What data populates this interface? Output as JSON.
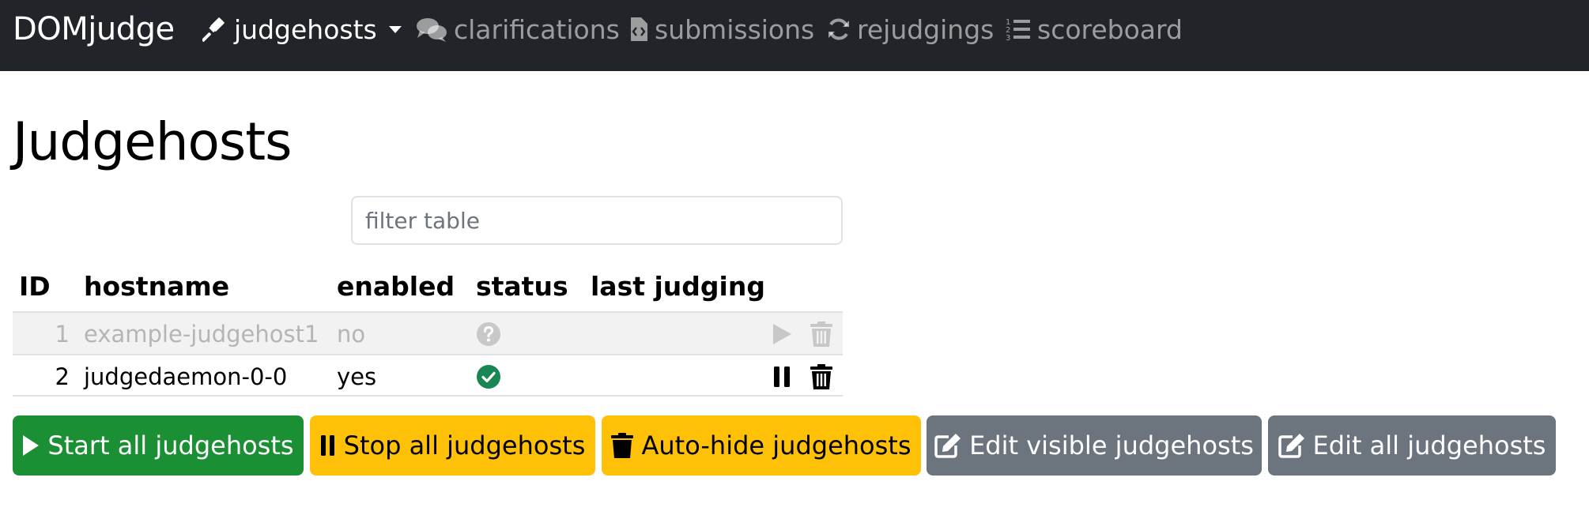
{
  "navbar": {
    "brand": "DOMjudge",
    "items": [
      {
        "label": "judgehosts",
        "icon": "gavel-icon"
      },
      {
        "label": "clarifications",
        "icon": "comments-icon"
      },
      {
        "label": "submissions",
        "icon": "file-code-icon"
      },
      {
        "label": "rejudgings",
        "icon": "sync-icon"
      },
      {
        "label": "scoreboard",
        "icon": "list-ol-icon"
      }
    ]
  },
  "page": {
    "title": "Judgehosts"
  },
  "filter": {
    "placeholder": "filter table",
    "value": ""
  },
  "table": {
    "columns": [
      "ID",
      "hostname",
      "enabled",
      "status",
      "last judging"
    ],
    "rows": [
      {
        "id": "1",
        "hostname": "example-judgehost1",
        "enabled": "no",
        "status": "unknown",
        "last_judging": "",
        "action": "start"
      },
      {
        "id": "2",
        "hostname": "judgedaemon-0-0",
        "enabled": "yes",
        "status": "ok",
        "last_judging": "",
        "action": "pause"
      }
    ]
  },
  "buttons": {
    "start_all": "Start all judgehosts",
    "stop_all": "Stop all judgehosts",
    "auto_hide": "Auto-hide judgehosts",
    "edit_visible": "Edit visible judgehosts",
    "edit_all": "Edit all judgehosts"
  },
  "colors": {
    "navbar_bg": "#212529",
    "success": "#1a8f34",
    "warning": "#ffc107",
    "secondary": "#6c757d",
    "status_ok": "#198754",
    "status_unknown": "#c8c8c8"
  }
}
